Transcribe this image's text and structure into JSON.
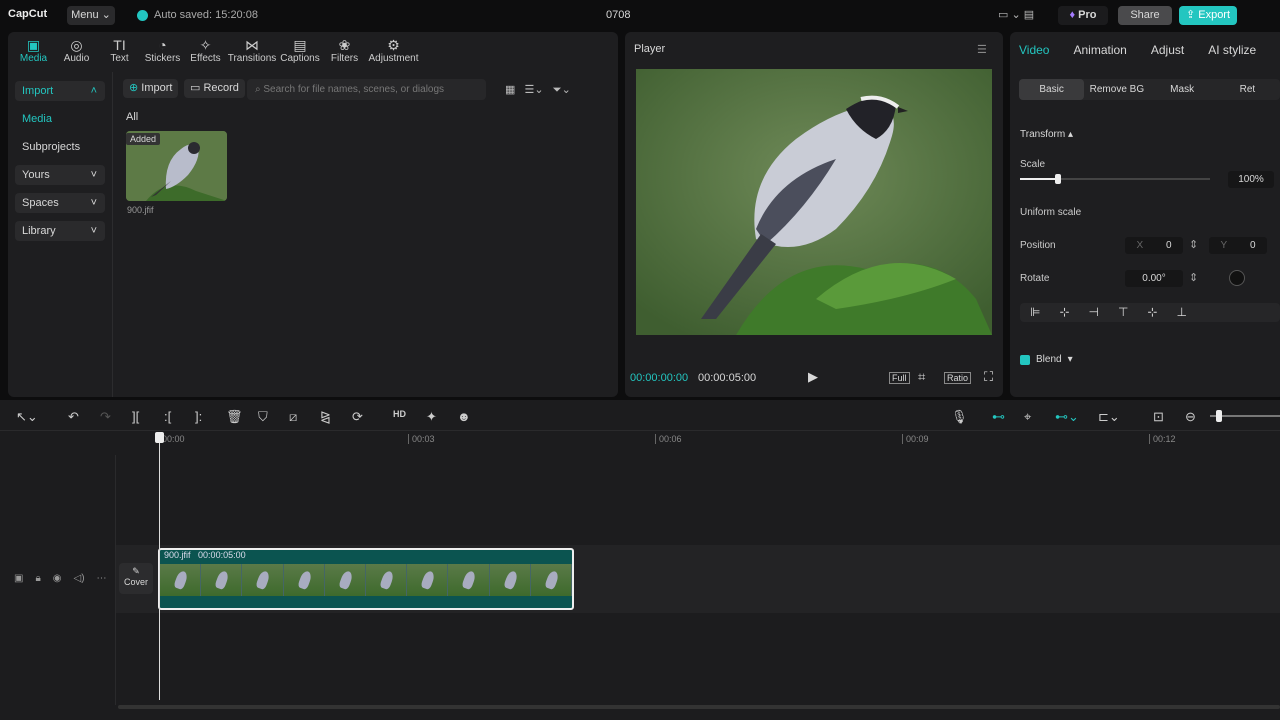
{
  "topbar": {
    "logo": "CapCut",
    "menu": "Menu",
    "autosave": "Auto saved: 15:20:08",
    "project_title": "0708",
    "pro": "Pro",
    "share": "Share",
    "export": "Export"
  },
  "toolbar_tabs": [
    {
      "label": "Media",
      "icon": "media-icon"
    },
    {
      "label": "Audio",
      "icon": "audio-icon"
    },
    {
      "label": "Text",
      "icon": "text-icon"
    },
    {
      "label": "Stickers",
      "icon": "stickers-icon"
    },
    {
      "label": "Effects",
      "icon": "effects-icon"
    },
    {
      "label": "Transitions",
      "icon": "transitions-icon"
    },
    {
      "label": "Captions",
      "icon": "captions-icon"
    },
    {
      "label": "Filters",
      "icon": "filters-icon"
    },
    {
      "label": "Adjustment",
      "icon": "adjustment-icon"
    }
  ],
  "sidebar": {
    "items": [
      {
        "label": "Import"
      },
      {
        "label": "Media"
      },
      {
        "label": "Subprojects"
      },
      {
        "label": "Yours"
      },
      {
        "label": "Spaces"
      },
      {
        "label": "Library"
      }
    ]
  },
  "media": {
    "import": "Import",
    "record": "Record",
    "search_placeholder": "Search for file names, scenes, or dialogs",
    "filter_all": "All",
    "item": {
      "badge": "Added",
      "name": "900.jfif"
    }
  },
  "player": {
    "title": "Player",
    "current_time": "00:00:00:00",
    "duration": "00:00:05:00",
    "full": "Full",
    "ratio": "Ratio"
  },
  "inspector": {
    "tabs": [
      "Video",
      "Animation",
      "Adjust",
      "AI stylize"
    ],
    "subtabs": [
      "Basic",
      "Remove BG",
      "Mask",
      "Ret"
    ],
    "transform": "Transform",
    "scale_label": "Scale",
    "scale_value": "100%",
    "scale_fraction": 0.2,
    "uniform_scale": "Uniform scale",
    "position_label": "Position",
    "x_label": "X",
    "x_value": "0",
    "y_label": "Y",
    "y_value": "0",
    "rotate_label": "Rotate",
    "rotate_value": "0.00°",
    "blend": "Blend"
  },
  "timeline": {
    "ruler": [
      "00:00",
      "00:03",
      "00:06",
      "00:09",
      "00:12"
    ],
    "cover": "Cover",
    "clip_name": "900.jfif",
    "clip_duration": "00:00:05:00"
  },
  "colors": {
    "accent": "#23c6c0",
    "clip": "#0b5450"
  }
}
